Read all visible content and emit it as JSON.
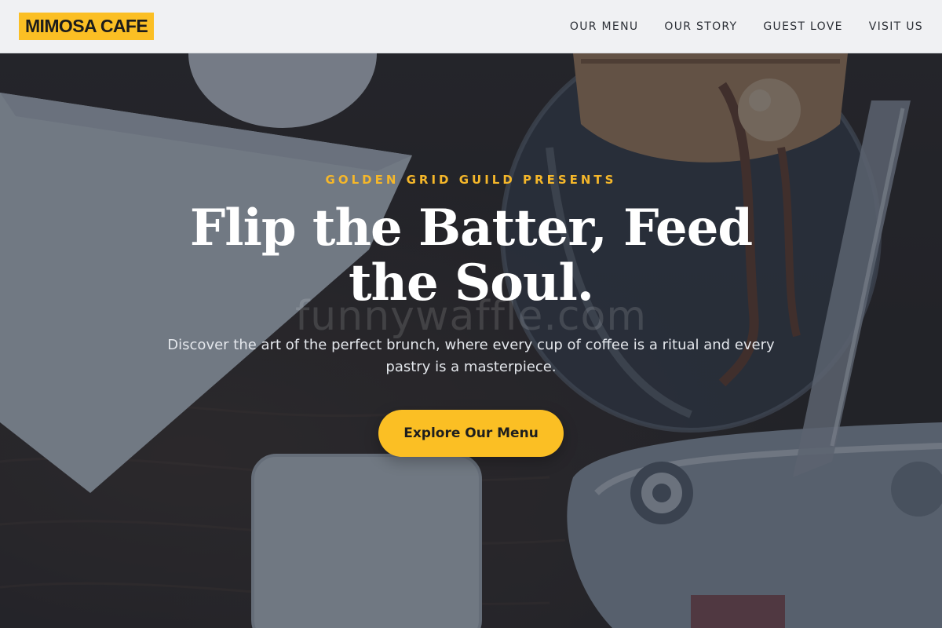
{
  "header": {
    "logo": "MIMOSA CAFE",
    "nav": [
      {
        "label": "OUR MENU"
      },
      {
        "label": "OUR STORY"
      },
      {
        "label": "GUEST LOVE"
      },
      {
        "label": "VISIT US"
      }
    ]
  },
  "hero": {
    "eyebrow": "GOLDEN GRID GUILD PRESENTS",
    "headline": "Flip the Batter, Feed the Soul.",
    "subtitle": "Discover the art of the perfect brunch, where every cup of coffee is a ritual and every pastry is a masterpiece.",
    "cta_label": "Explore Our Menu",
    "watermark": "funnywaffle.com"
  },
  "colors": {
    "accent": "#fbbf24",
    "header_bg": "#f0f1f3",
    "overlay": "#1e2634"
  }
}
